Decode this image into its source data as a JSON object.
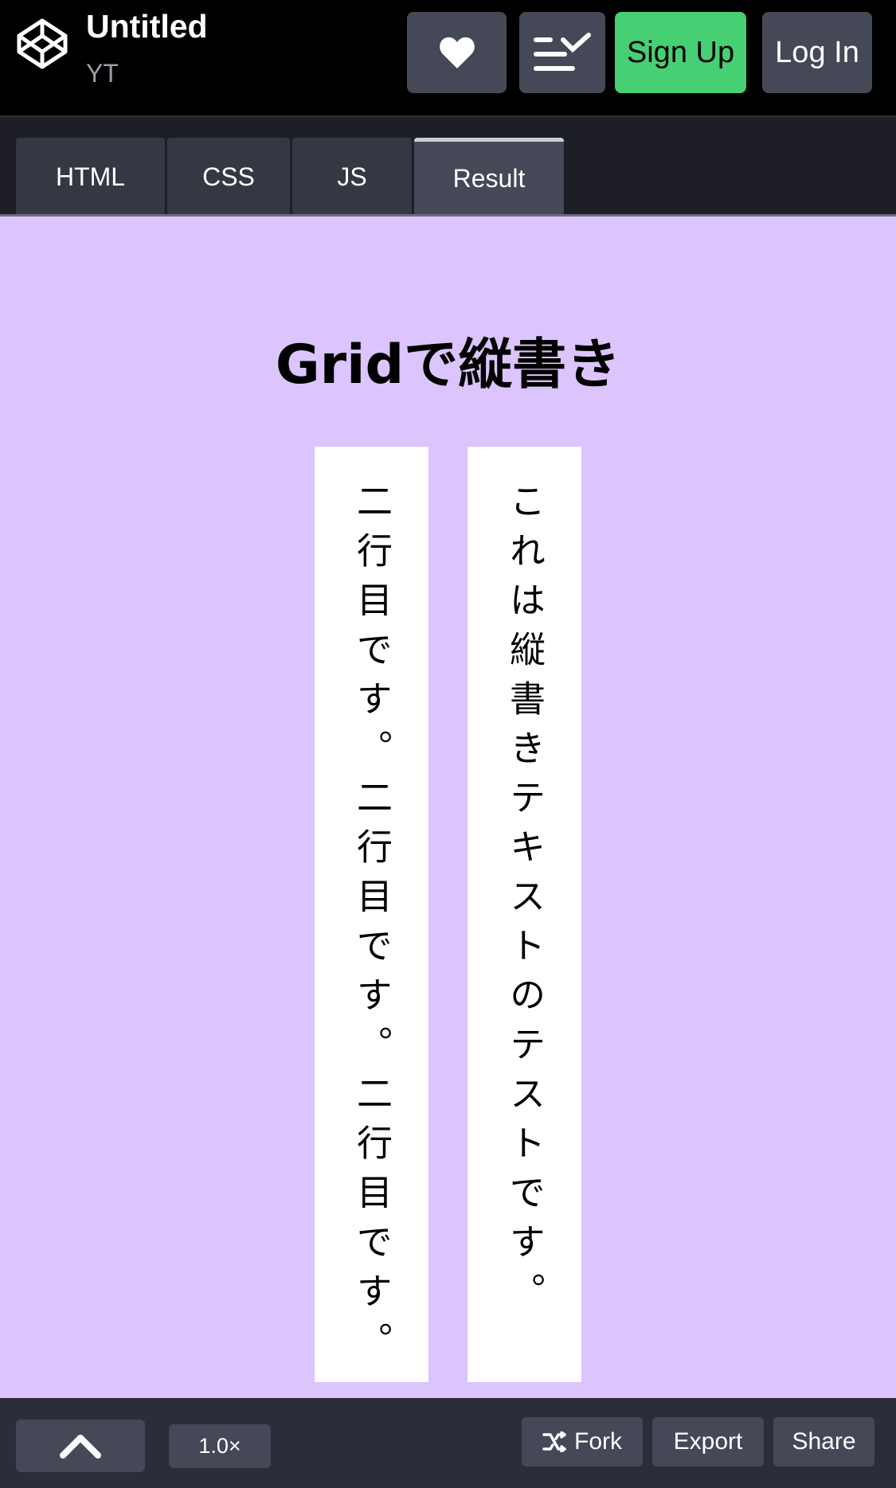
{
  "header": {
    "title": "Untitled",
    "author": "YT",
    "signup_label": "Sign Up",
    "login_label": "Log In"
  },
  "tabs": [
    {
      "label": "HTML"
    },
    {
      "label": "CSS"
    },
    {
      "label": "JS"
    },
    {
      "label": "Result",
      "active": true
    }
  ],
  "preview": {
    "heading": "Gridで縦書き",
    "column_right_text": "これは縦書きテキストのテストです。",
    "column_left_text": "二行目です。二行目です。二行目です。"
  },
  "footer": {
    "zoom": "1.0×",
    "fork_label": "Fork",
    "export_label": "Export",
    "share_label": "Share"
  },
  "colors": {
    "preview_bg": "#dcc4fd",
    "signup_bg": "#47cf73",
    "button_bg": "#444857"
  },
  "icons": [
    "codepen-logo-icon",
    "heart-icon",
    "list-check-icon",
    "chevron-up-icon",
    "fork-icon"
  ]
}
